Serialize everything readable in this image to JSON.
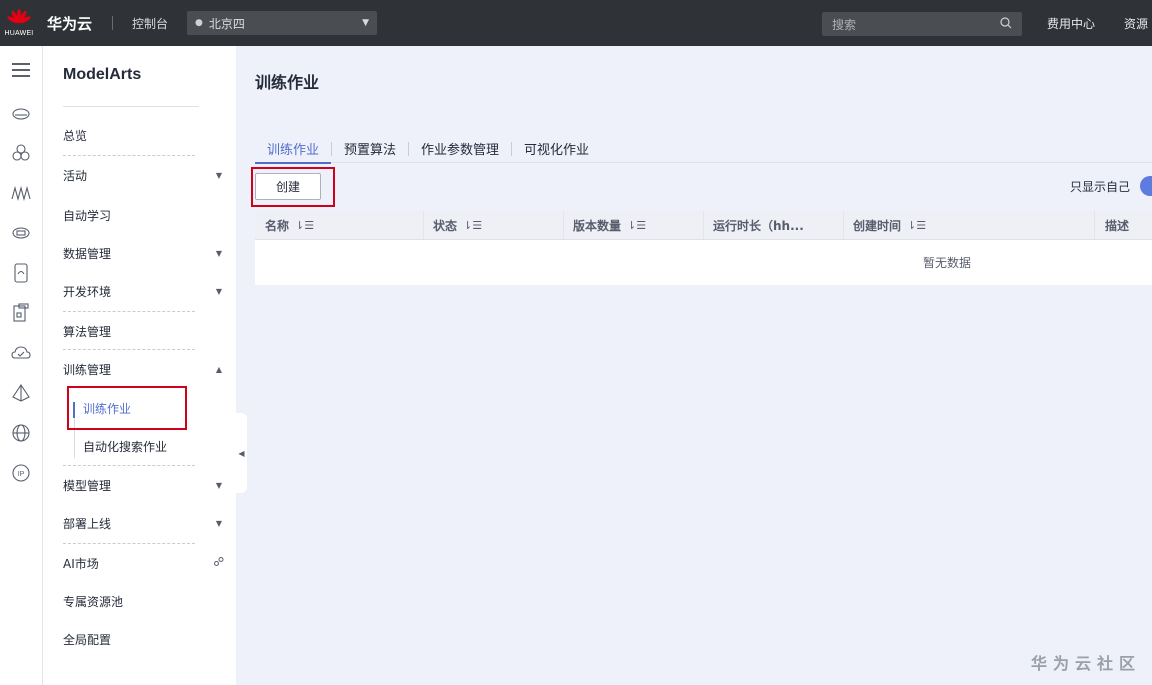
{
  "topbar": {
    "logo_text": "HUAWEI",
    "brand": "华为云",
    "console": "控制台",
    "region": "北京四",
    "search_placeholder": "搜索",
    "links": [
      "费用中心",
      "资源"
    ]
  },
  "rail": {
    "icons": [
      "menu-icon",
      "cloud-server-icon",
      "cluster-icon",
      "analytics-icon",
      "storage-icon",
      "mobile-icon",
      "app-icon",
      "cloud-monitor-icon",
      "network-icon",
      "globe-icon",
      "ip-icon"
    ]
  },
  "sidebar": {
    "title": "ModelArts",
    "items": [
      {
        "label": "总览",
        "arrow": ""
      },
      {
        "label": "活动",
        "arrow": "▼"
      },
      {
        "label": "自动学习",
        "arrow": ""
      },
      {
        "label": "数据管理",
        "arrow": "▼"
      },
      {
        "label": "开发环境",
        "arrow": "▼"
      },
      {
        "label": "算法管理",
        "arrow": ""
      },
      {
        "label": "训练管理",
        "arrow": "▲"
      },
      {
        "label": "模型管理",
        "arrow": "▼"
      },
      {
        "label": "部署上线",
        "arrow": "▼"
      },
      {
        "label": "AI市场",
        "arrow": "🔗"
      },
      {
        "label": "专属资源池",
        "arrow": ""
      },
      {
        "label": "全局配置",
        "arrow": ""
      }
    ],
    "sub_items": [
      {
        "label": "训练作业",
        "active": true
      },
      {
        "label": "自动化搜索作业",
        "active": false
      }
    ]
  },
  "main": {
    "title": "训练作业",
    "tabs": [
      {
        "label": "训练作业",
        "active": true
      },
      {
        "label": "预置算法",
        "active": false
      },
      {
        "label": "作业参数管理",
        "active": false
      },
      {
        "label": "可视化作业",
        "active": false
      }
    ],
    "create_button": "创建",
    "only_mine_label": "只显示自己",
    "table": {
      "columns": [
        "名称",
        "状态",
        "版本数量",
        "运行时长（hh...",
        "创建时间",
        "描述"
      ],
      "sortable": [
        true,
        true,
        true,
        false,
        true,
        false
      ],
      "empty_text": "暂无数据"
    }
  },
  "watermark": "华为云社区",
  "colors": {
    "accent": "#526ecc",
    "topbar_bg": "#2f3337",
    "highlight_box": "#d0021b",
    "page_bg": "#eef1fa"
  }
}
